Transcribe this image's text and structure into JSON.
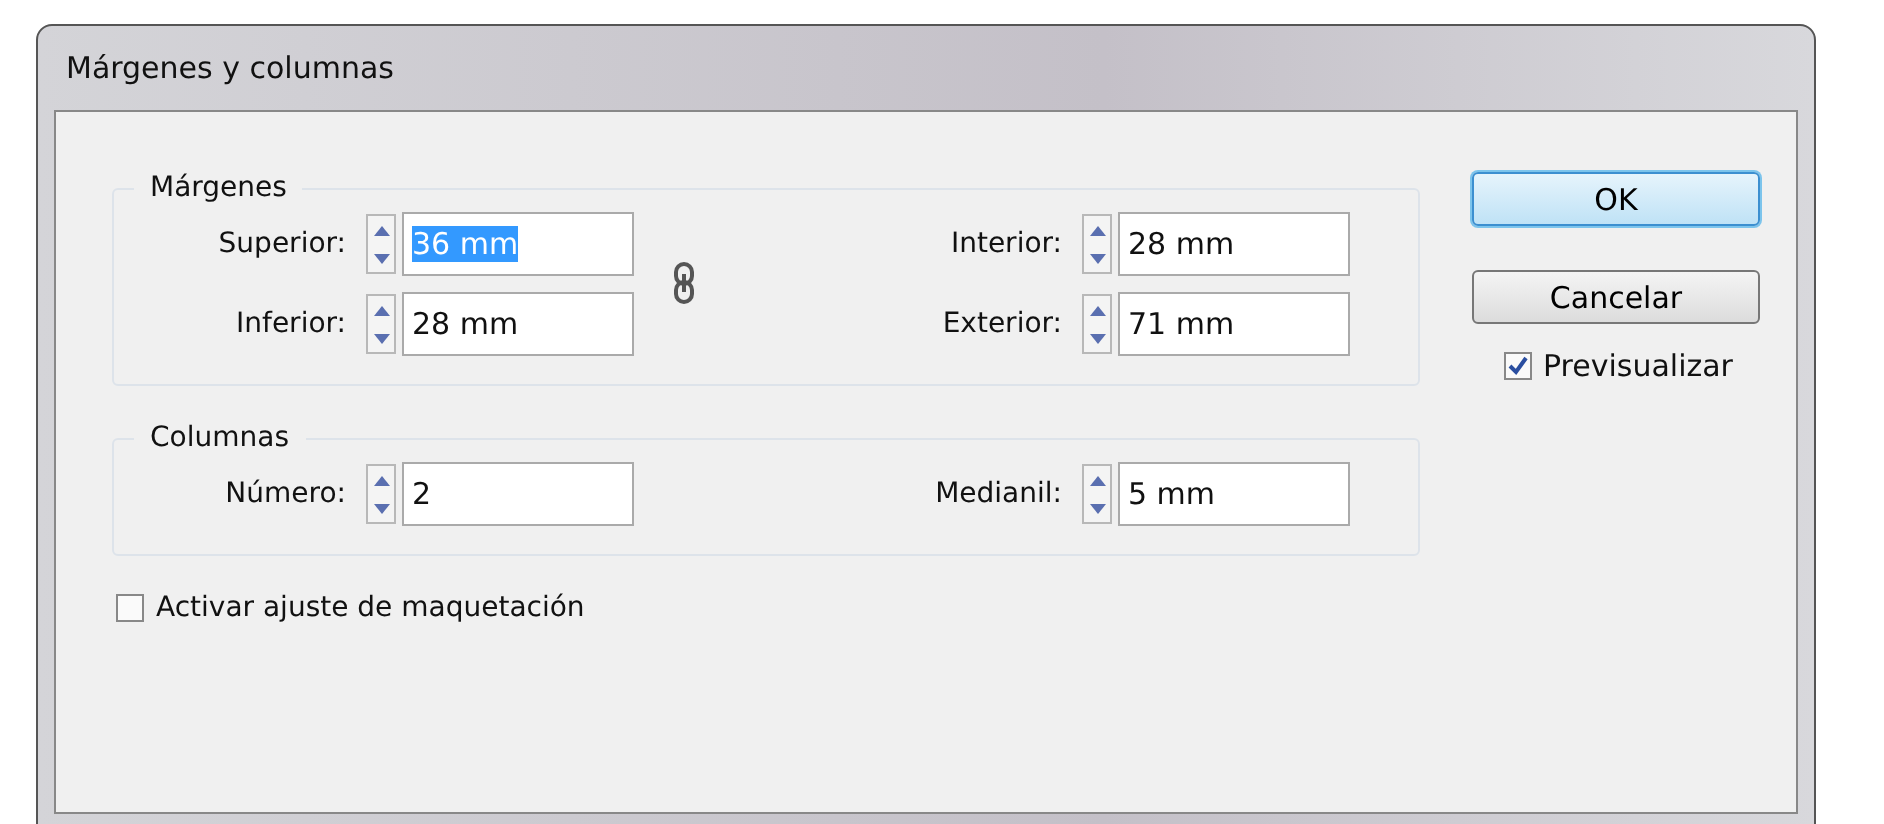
{
  "window": {
    "title": "Márgenes y columnas"
  },
  "margins": {
    "legend": "Márgenes",
    "fields": [
      {
        "label": "Superior:",
        "value": "36 mm",
        "text_selected": true
      },
      {
        "label": "Interior:",
        "value": "28 mm",
        "text_selected": false
      },
      {
        "label": "Inferior:",
        "value": "28 mm",
        "text_selected": false
      },
      {
        "label": "Exterior:",
        "value": "71 mm",
        "text_selected": false
      }
    ]
  },
  "columns": {
    "legend": "Columnas",
    "fields": [
      {
        "label": "Número:",
        "value": "2",
        "text_selected": false
      },
      {
        "label": "Medianil:",
        "value": "5 mm",
        "text_selected": false
      }
    ]
  },
  "layout_adjust": {
    "label": "Activar ajuste de maquetación",
    "checked": false
  },
  "buttons": [
    {
      "label": "OK",
      "default": true
    },
    {
      "label": "Cancelar",
      "default": false
    }
  ],
  "preview": {
    "label": "Previsualizar",
    "checked": true
  }
}
